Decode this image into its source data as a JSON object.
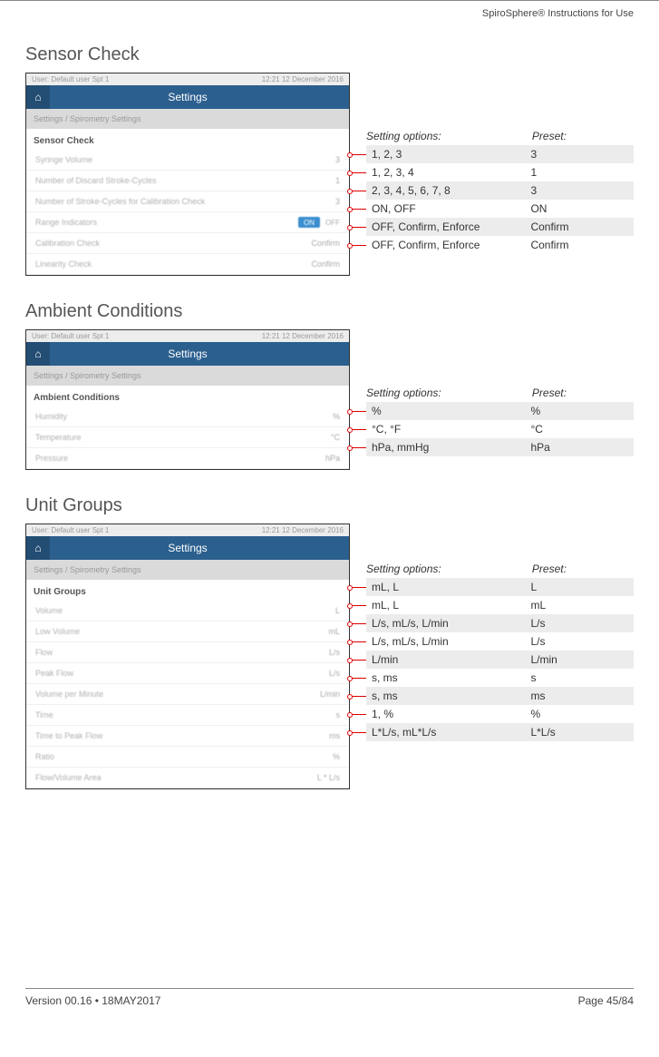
{
  "doc_header": "SpiroSphere® Instructions for Use",
  "footer_left": "Version 00.16 • 18MAY2017",
  "footer_right": "Page 45/84",
  "setting_options_label": "Setting options:",
  "preset_label": "Preset:",
  "sections": {
    "sensor": {
      "title": "Sensor Check",
      "shot": {
        "topbar_left": "User: Default user Spt 1",
        "topbar_right": "12:21 12 December 2016",
        "header": "Settings",
        "breadcrumb": "Settings / Spirometry Settings",
        "section_label": "Sensor Check",
        "rows": [
          {
            "lbl": "Syringe Volume",
            "val": "3"
          },
          {
            "lbl": "Number of Discard Stroke-Cycles",
            "val": "1"
          },
          {
            "lbl": "Number of Stroke-Cycles for Calibration Check",
            "val": "3"
          },
          {
            "lbl": "Range Indicators",
            "val": "TOGGLE"
          },
          {
            "lbl": "Calibration Check",
            "val": "Confirm"
          },
          {
            "lbl": "Linearity Check",
            "val": "Confirm"
          }
        ]
      },
      "opts": [
        {
          "options": "1, 2, 3",
          "preset": "3",
          "shade": true
        },
        {
          "options": "1, 2, 3, 4",
          "preset": "1",
          "shade": false
        },
        {
          "options": "2, 3, 4, 5, 6, 7, 8",
          "preset": "3",
          "shade": true
        },
        {
          "options": "ON, OFF",
          "preset": "ON",
          "shade": false
        },
        {
          "options": "OFF, Confirm, Enforce",
          "preset": "Confirm",
          "shade": true
        },
        {
          "options": "OFF, Confirm, Enforce",
          "preset": "Confirm",
          "shade": false
        }
      ]
    },
    "ambient": {
      "title": "Ambient Conditions",
      "shot": {
        "topbar_left": "User: Default user Spt 1",
        "topbar_right": "12:21 12 December 2016",
        "header": "Settings",
        "breadcrumb": "Settings / Spirometry Settings",
        "section_label": "Ambient Conditions",
        "rows": [
          {
            "lbl": "Humidity",
            "val": "%"
          },
          {
            "lbl": "Temperature",
            "val": "°C"
          },
          {
            "lbl": "Pressure",
            "val": "hPa"
          }
        ]
      },
      "opts": [
        {
          "options": "%",
          "preset": "%",
          "shade": true
        },
        {
          "options": "°C, °F",
          "preset": "°C",
          "shade": false
        },
        {
          "options": "hPa, mmHg",
          "preset": "hPa",
          "shade": true
        }
      ]
    },
    "units": {
      "title": "Unit Groups",
      "shot": {
        "topbar_left": "User: Default user Spt 1",
        "topbar_right": "12:21 12 December 2016",
        "header": "Settings",
        "breadcrumb": "Settings / Spirometry Settings",
        "section_label": "Unit Groups",
        "rows": [
          {
            "lbl": "Volume",
            "val": "L"
          },
          {
            "lbl": "Low Volume",
            "val": "mL"
          },
          {
            "lbl": "Flow",
            "val": "L/s"
          },
          {
            "lbl": "Peak Flow",
            "val": "L/s"
          },
          {
            "lbl": "Volume per Minute",
            "val": "L/min"
          },
          {
            "lbl": "Time",
            "val": "s"
          },
          {
            "lbl": "Time to Peak Flow",
            "val": "ms"
          },
          {
            "lbl": "Ratio",
            "val": "%"
          },
          {
            "lbl": "Flow/Volume Area",
            "val": "L * L/s"
          }
        ]
      },
      "opts": [
        {
          "options": "mL, L",
          "preset": "L",
          "shade": true
        },
        {
          "options": "mL, L",
          "preset": "mL",
          "shade": false
        },
        {
          "options": "L/s, mL/s, L/min",
          "preset": "L/s",
          "shade": true
        },
        {
          "options": "L/s, mL/s, L/min",
          "preset": "L/s",
          "shade": false
        },
        {
          "options": "L/min",
          "preset": "L/min",
          "shade": true
        },
        {
          "options": "s, ms",
          "preset": "s",
          "shade": false
        },
        {
          "options": "s, ms",
          "preset": "ms",
          "shade": true
        },
        {
          "options": "1, %",
          "preset": "%",
          "shade": false
        },
        {
          "options": "L*L/s, mL*L/s",
          "preset": "L*L/s",
          "shade": true
        }
      ]
    }
  }
}
